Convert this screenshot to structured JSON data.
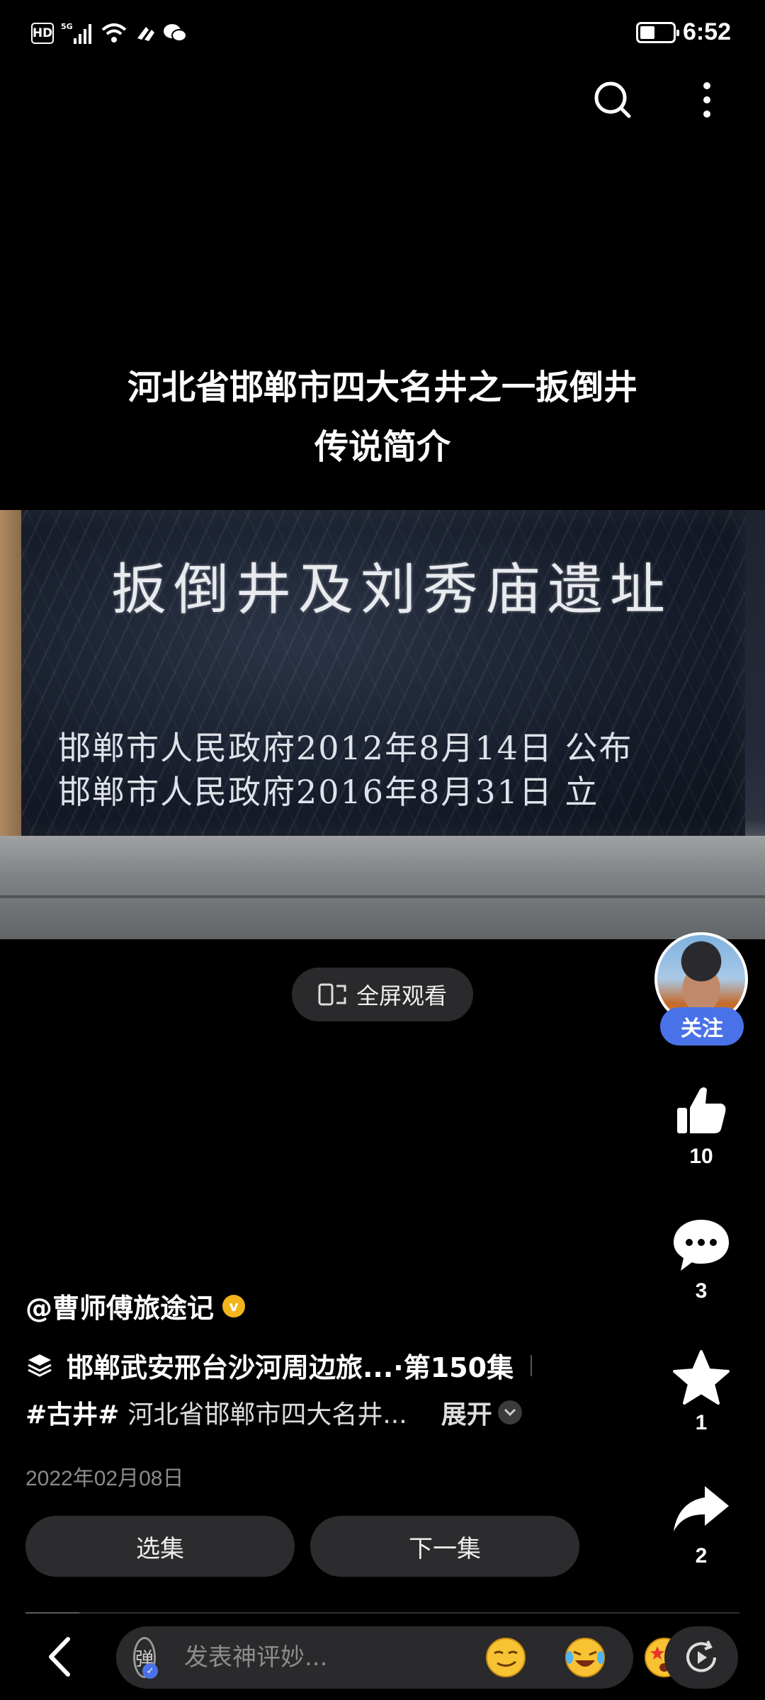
{
  "status_bar": {
    "network": "5G",
    "hd_label": "HD",
    "time": "6:52",
    "battery_level": 0.45
  },
  "top_actions": {
    "search_icon": "search-icon",
    "more_icon": "more-vertical-icon"
  },
  "video": {
    "title_line1": "河北省邯郸市四大名井之一扳倒井",
    "title_line2": "传说简介",
    "plaque_title": "扳倒井及刘秀庙遗址",
    "plaque_line1": "邯郸市人民政府2012年8月14日 公布",
    "plaque_line2": "邯郸市人民政府2016年8月31日     立"
  },
  "fullscreen": {
    "label": "全屏观看",
    "icon": "fullscreen-icon"
  },
  "rail": {
    "follow_label": "关注",
    "like_count": "10",
    "comment_count": "3",
    "favorite_count": "1",
    "share_count": "2"
  },
  "info": {
    "author": "@曹师傅旅途记",
    "collection": "邯郸武安邢台沙河周边旅...·第150集",
    "hashtag": "#古井#",
    "description": "河北省邯郸市四大名井...",
    "expand_label": "展开",
    "date": "2022年02月08日"
  },
  "episode_buttons": {
    "select_label": "选集",
    "next_label": "下一集"
  },
  "progress": {
    "fraction": 0.075
  },
  "bottom_bar": {
    "danmaku_label": "弹",
    "comment_placeholder": "发表神评妙...",
    "emojis": [
      "smirk-emoji",
      "laugh-cry-emoji",
      "star-eyes-emoji"
    ]
  },
  "colors": {
    "accent": "#4a72e8",
    "verified": "#f2b51b",
    "background": "#000000"
  }
}
